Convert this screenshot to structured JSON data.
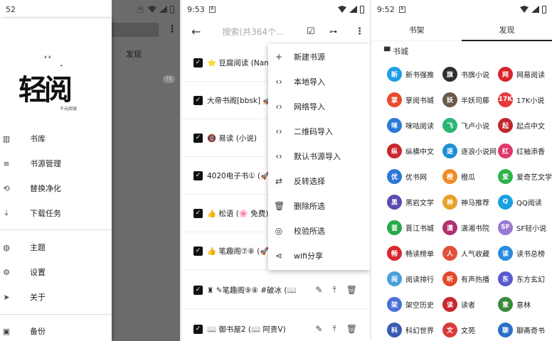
{
  "panel1": {
    "time": "52",
    "app_name": "轻阅",
    "app_tagline": "千元阅读",
    "scrim_tab": "发现",
    "scrim_badge": "71",
    "menu": [
      {
        "label": "书库",
        "icon": "library-icon",
        "glyph": "▥"
      },
      {
        "label": "书源管理",
        "icon": "list-icon",
        "glyph": "≡"
      },
      {
        "label": "替换净化",
        "icon": "replace-search-icon",
        "glyph": "⟲"
      },
      {
        "label": "下载任务",
        "icon": "download-icon",
        "glyph": "⤓"
      },
      {
        "label": "主题",
        "icon": "palette-icon",
        "glyph": "◍"
      },
      {
        "label": "设置",
        "icon": "gear-icon",
        "glyph": "⚙"
      },
      {
        "label": "关于",
        "icon": "send-icon",
        "glyph": "➤"
      },
      {
        "label": "备份",
        "icon": "backup-icon",
        "glyph": "▣"
      }
    ]
  },
  "panel2": {
    "time": "9:53",
    "search_placeholder": "搜索(共364个...",
    "sources": [
      {
        "name": "⭐ 豆腐阅读 (Nam"
      },
      {
        "name": "大帝书阁[bbsk] 🚀"
      },
      {
        "name": "🔞 易读 (小说)"
      },
      {
        "name": "4020电子书① (🚀"
      },
      {
        "name": "👍 松语 (🌸 免费)"
      },
      {
        "name": "👍 笔趣阁⑦⑧ (🚀"
      },
      {
        "name": "♜ ✎笔趣阁⑨⑧ #破冰 (📖"
      },
      {
        "name": "📖 御书屋2 (📖 阿贵V)"
      }
    ],
    "popup": [
      {
        "label": "新建书源",
        "glyph": "+"
      },
      {
        "label": "本地导入",
        "glyph": "‹›"
      },
      {
        "label": "网络导入",
        "glyph": "‹›"
      },
      {
        "label": "二维码导入",
        "glyph": "‹›"
      },
      {
        "label": "默认书源导入",
        "glyph": "‹›"
      },
      {
        "label": "反转选择",
        "glyph": "⇄"
      },
      {
        "label": "删除所选",
        "glyph": "🗑"
      },
      {
        "label": "校验所选",
        "glyph": "◎"
      },
      {
        "label": "wifi分享",
        "glyph": "⋖"
      }
    ]
  },
  "panel3": {
    "time": "9:52",
    "tabs": [
      "书架",
      "发现"
    ],
    "partial_header": "▀ 书城",
    "sites": [
      {
        "label": "新书强推",
        "color": "#1e9ee8",
        "g": "新"
      },
      {
        "label": "书旗小说",
        "color": "#2f2f2f",
        "g": "旗"
      },
      {
        "label": "网易阅读",
        "color": "#d9262a",
        "g": "网"
      },
      {
        "label": "掌阅书城",
        "color": "#e94b2b",
        "g": "掌"
      },
      {
        "label": "半妖司藤",
        "color": "#6b5a4a",
        "g": "妖"
      },
      {
        "label": "17K小说",
        "color": "#e63a3a",
        "g": "17K"
      },
      {
        "label": "咪咕阅读",
        "color": "#2a7ad6",
        "g": "咪"
      },
      {
        "label": "飞卢小说",
        "color": "#2bb673",
        "g": "飞"
      },
      {
        "label": "起点中文",
        "color": "#c0282d",
        "g": "起"
      },
      {
        "label": "纵横中文",
        "color": "#c8282d",
        "g": "纵"
      },
      {
        "label": "逐浪小说网",
        "color": "#1b8fd6",
        "g": "逐"
      },
      {
        "label": "红袖添香",
        "color": "#e2386a",
        "g": "红"
      },
      {
        "label": "优书网",
        "color": "#2b78d8",
        "g": "优"
      },
      {
        "label": "橙瓜",
        "color": "#f08a24",
        "g": "橙"
      },
      {
        "label": "爱奇艺文学",
        "color": "#2fb34a",
        "g": "爱"
      },
      {
        "label": "黑岩文学",
        "color": "#5a4bb0",
        "g": "黑"
      },
      {
        "label": "神马推荐",
        "color": "#e7a12a",
        "g": "神"
      },
      {
        "label": "QQ阅读",
        "color": "#1aa0e0",
        "g": "Q"
      },
      {
        "label": "晋江书城",
        "color": "#2aa84a",
        "g": "晋"
      },
      {
        "label": "潇湘书院",
        "color": "#b0326e",
        "g": "潇"
      },
      {
        "label": "SF轻小说",
        "color": "#9a78d0",
        "g": "SF"
      },
      {
        "label": "畅读榜单",
        "color": "#d8282d",
        "g": "畅"
      },
      {
        "label": "人气收藏",
        "color": "#e0503a",
        "g": "人"
      },
      {
        "label": "读书总榜",
        "color": "#2b8be0",
        "g": "读"
      },
      {
        "label": "阅读排行",
        "color": "#4aa0d8",
        "g": "阅"
      },
      {
        "label": "有声热播",
        "color": "#e24a2a",
        "g": "听"
      },
      {
        "label": "东方玄幻",
        "color": "#5a5ad0",
        "g": "东"
      },
      {
        "label": "架空历史",
        "color": "#4a70d8",
        "g": "架"
      },
      {
        "label": "读者",
        "color": "#c8282d",
        "g": "读"
      },
      {
        "label": "意林",
        "color": "#3a8a3a",
        "g": "意"
      },
      {
        "label": "科幻世界",
        "color": "#3a5ab0",
        "g": "科"
      },
      {
        "label": "文苑",
        "color": "#d83a3a",
        "g": "文"
      },
      {
        "label": "聊斋奇书",
        "color": "#2a70c8",
        "g": "聊"
      }
    ]
  }
}
